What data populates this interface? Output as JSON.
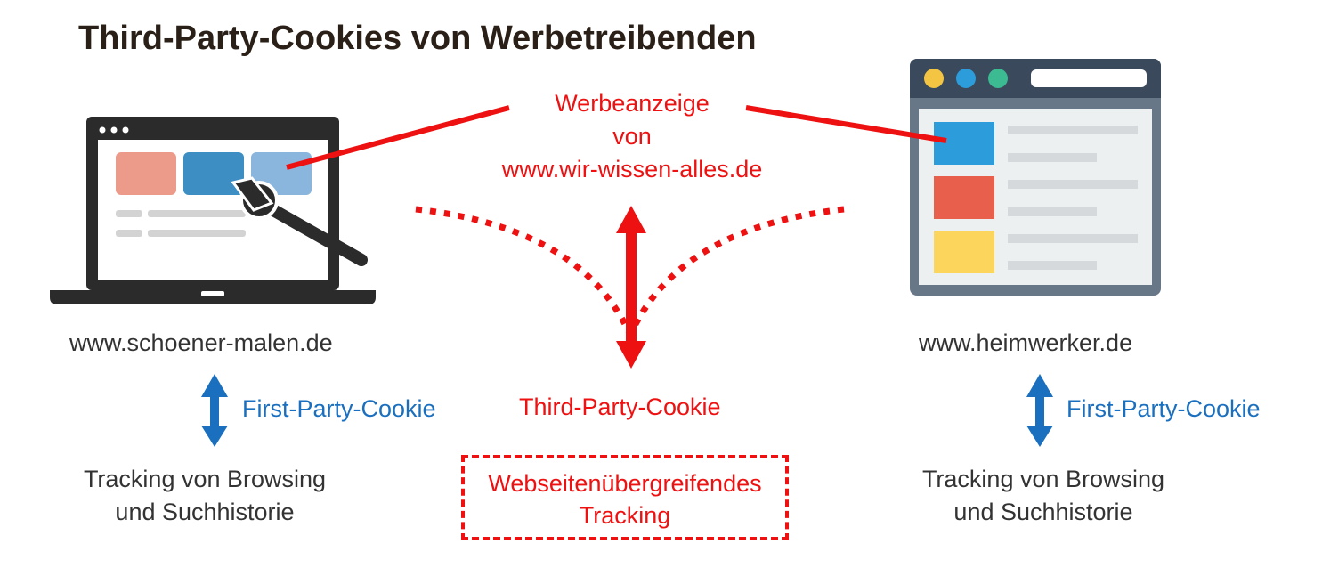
{
  "title": "Third-Party-Cookies von Werbetreibenden",
  "ad_label": [
    "Werbeanzeige",
    "von",
    "www.wir-wissen-alles.de"
  ],
  "left_site": {
    "domain": "www.schoener-malen.de",
    "cookie": "First-Party-Cookie",
    "tracking": [
      "Tracking von Browsing",
      "und Suchhistorie"
    ]
  },
  "right_site": {
    "domain": "www.heimwerker.de",
    "cookie": "First-Party-Cookie",
    "tracking": [
      "Tracking von Browsing",
      "und Suchhistorie"
    ]
  },
  "third_party_cookie": "Third-Party-Cookie",
  "cross_site_tracking": [
    "Webseitenübergreifendes",
    "Tracking"
  ],
  "colors": {
    "red": "#ee1111",
    "blue": "#1a6fbf",
    "title": "#2a2018"
  },
  "icons": {
    "laptop": "laptop-paintbrush-icon",
    "browser": "browser-window-icon"
  }
}
